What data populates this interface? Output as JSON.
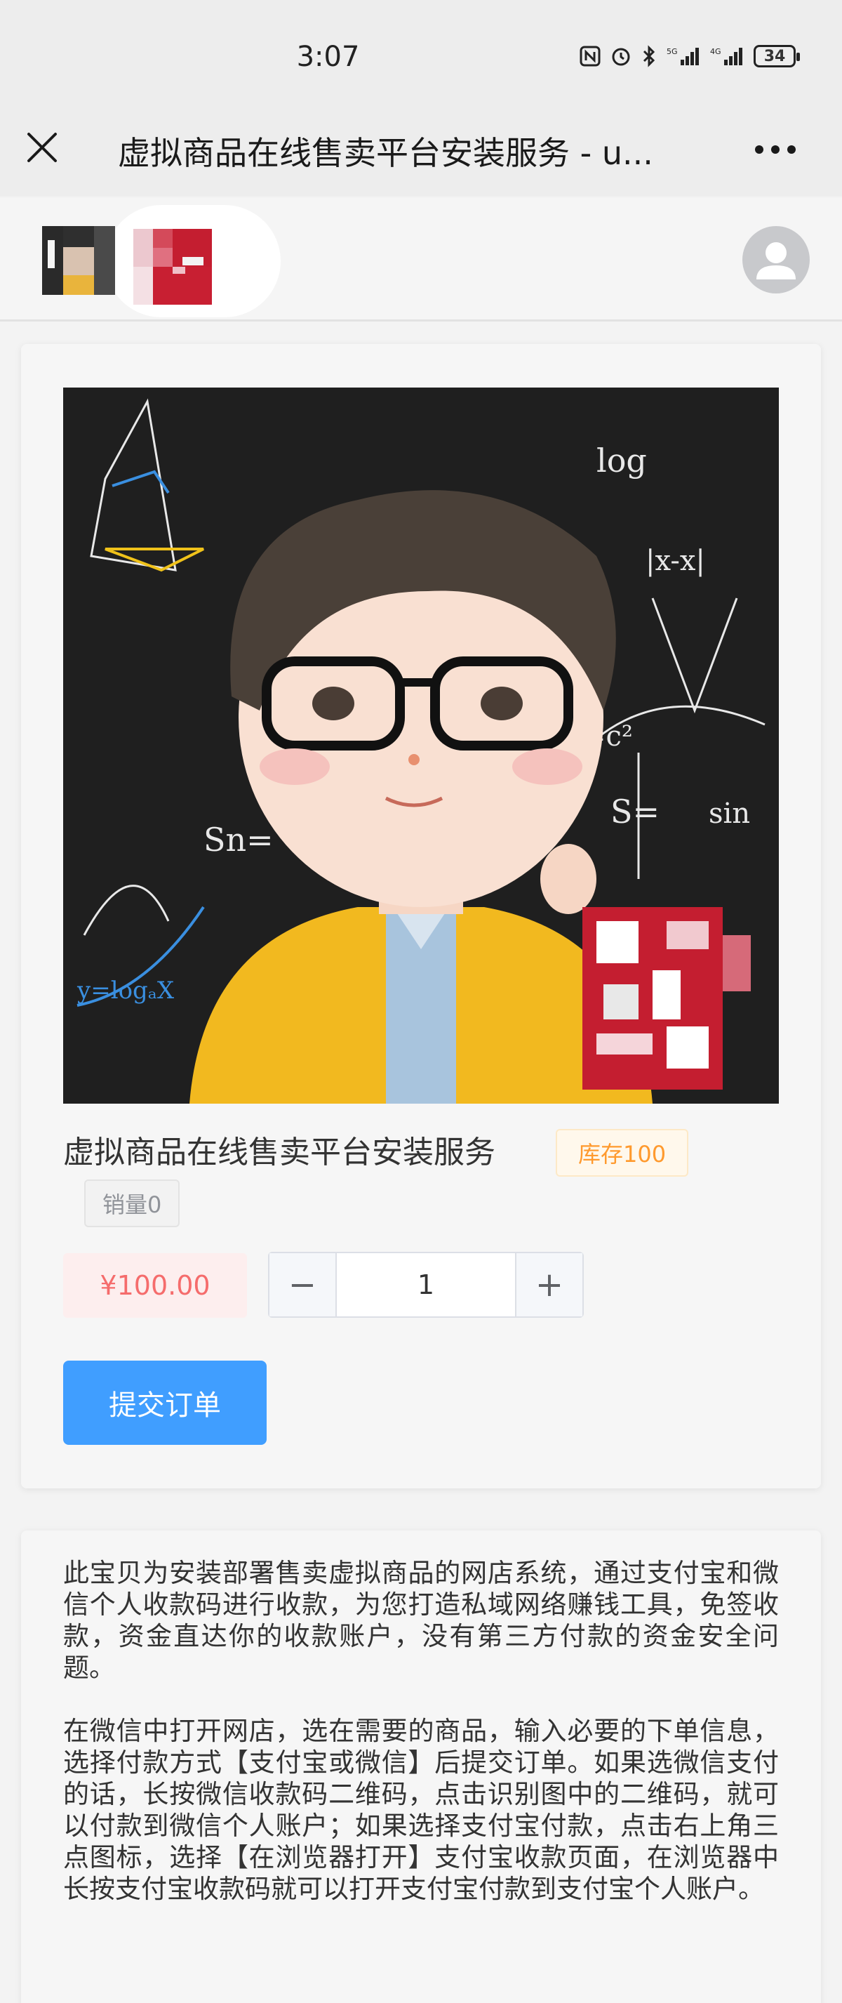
{
  "status_bar": {
    "time": "3:07",
    "network": "4G",
    "battery": "34"
  },
  "title_bar": {
    "title": "虚拟商品在线售卖平台安装服务 - u..."
  },
  "header": {
    "logo_a_icon": "avatar-thumbnail-icon",
    "logo_b_icon": "qr-thumbnail-icon"
  },
  "product": {
    "name": "虚拟商品在线售卖平台安装服务",
    "stock": "库存100",
    "sales": "销量0",
    "price": "¥100.00",
    "quantity": "1",
    "minus": "−",
    "plus": "+",
    "submit": "提交订单",
    "image_formulas": {
      "f1": "log",
      "f2": "S=",
      "f3": "Sn=",
      "f4": "y=logₐX",
      "f5": "sin",
      "f6": "=c²",
      "f7": "|x-x|"
    }
  },
  "description": {
    "p1": "此宝贝为安装部署售卖虚拟商品的网店系统，通过支付宝和微信个人收款码进行收款，为您打造私域网络赚钱工具，免签收款，资金直达你的收款账户，没有第三方付款的资金安全问题。",
    "p2": "在微信中打开网店，选在需要的商品，输入必要的下单信息，选择付款方式【支付宝或微信】后提交订单。如果选微信支付的话，长按微信收款码二维码，点击识别图中的二维码，就可以付款到微信个人账户；如果选择支付宝付款，点击右上角三点图标，选择【在浏览器打开】支付宝收款页面，在浏览器中长按支付宝收款码就可以打开支付宝付款到支付宝个人账户。"
  },
  "colors": {
    "accent": "#409eff",
    "price": "#f56c6c",
    "stock": "#ff9a2e"
  }
}
